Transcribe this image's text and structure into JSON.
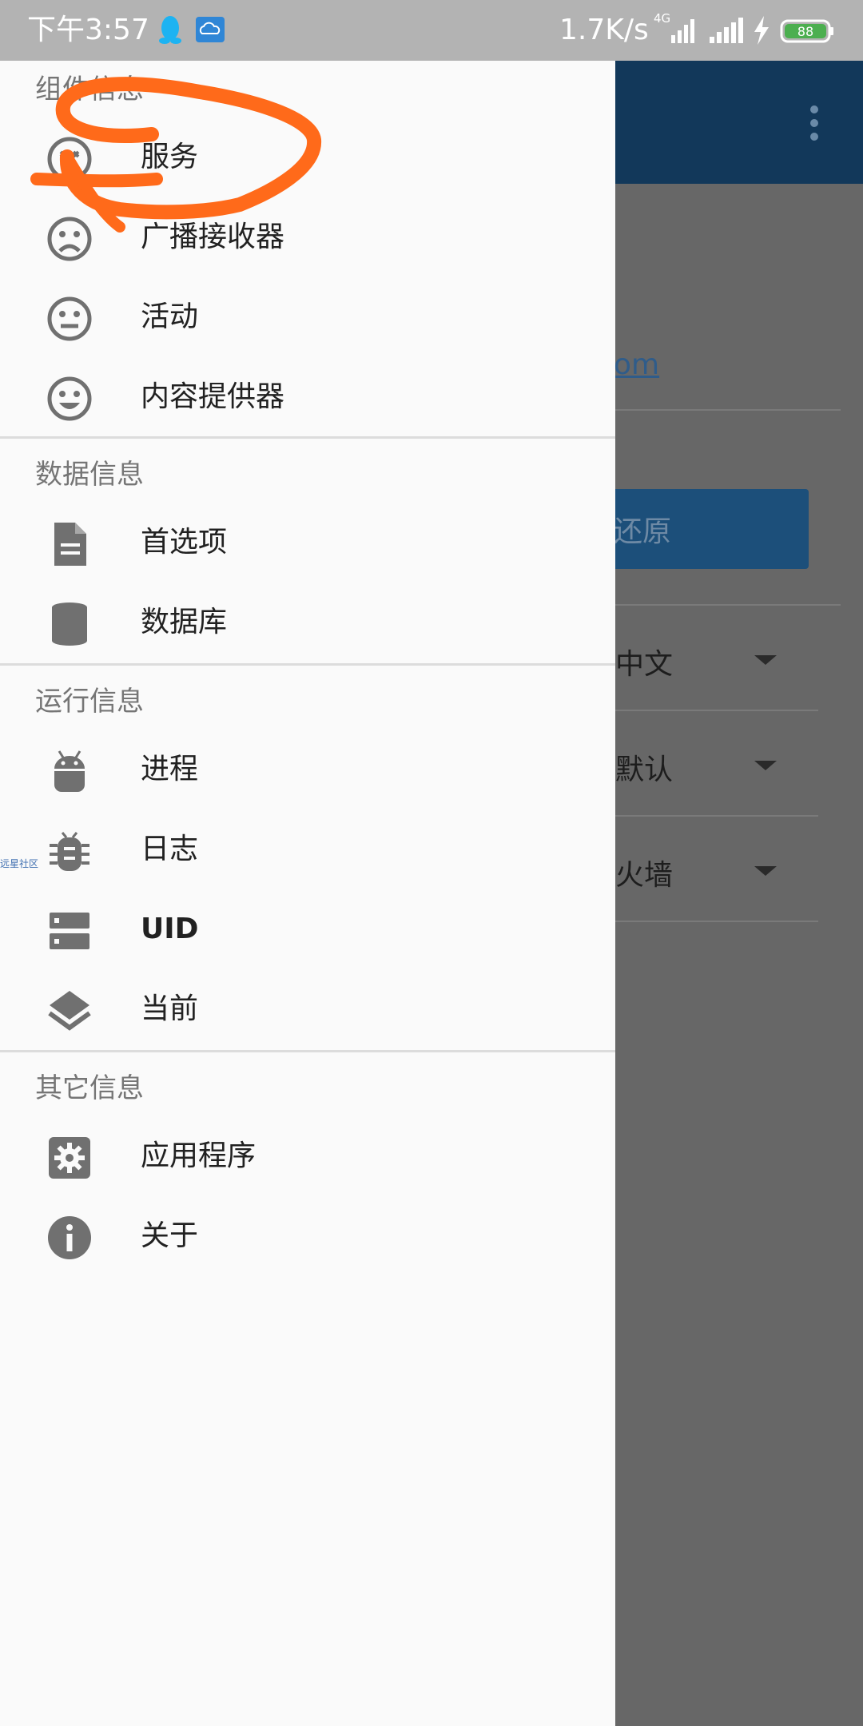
{
  "status_bar": {
    "time": "下午3:57",
    "network_speed": "1.7K/s",
    "network_type": "4G",
    "battery": "88"
  },
  "background_app": {
    "link_text": "om",
    "button_label": "还原",
    "selects": [
      "中文",
      "默认",
      "火墙"
    ]
  },
  "drawer": {
    "sections": [
      {
        "title": "组件信息",
        "items": [
          {
            "label": "服务",
            "icon": "service-icon"
          },
          {
            "label": "广播接收器",
            "icon": "sad-face-icon"
          },
          {
            "label": "活动",
            "icon": "neutral-face-icon"
          },
          {
            "label": "内容提供器",
            "icon": "happy-face-icon"
          }
        ]
      },
      {
        "title": "数据信息",
        "items": [
          {
            "label": "首选项",
            "icon": "document-icon"
          },
          {
            "label": "数据库",
            "icon": "database-icon"
          }
        ]
      },
      {
        "title": "运行信息",
        "items": [
          {
            "label": "进程",
            "icon": "android-icon"
          },
          {
            "label": "日志",
            "icon": "bug-icon"
          },
          {
            "label": "UID",
            "icon": "storage-icon"
          },
          {
            "label": "当前",
            "icon": "layers-icon"
          }
        ]
      },
      {
        "title": "其它信息",
        "items": [
          {
            "label": "应用程序",
            "icon": "gear-icon"
          },
          {
            "label": "关于",
            "icon": "info-icon"
          }
        ]
      }
    ]
  },
  "watermark": "远星社区",
  "colors": {
    "drawer_bg": "#fafafa",
    "toolbar": "#12385a",
    "icon": "#707070",
    "annotation": "#ff6a1a"
  }
}
